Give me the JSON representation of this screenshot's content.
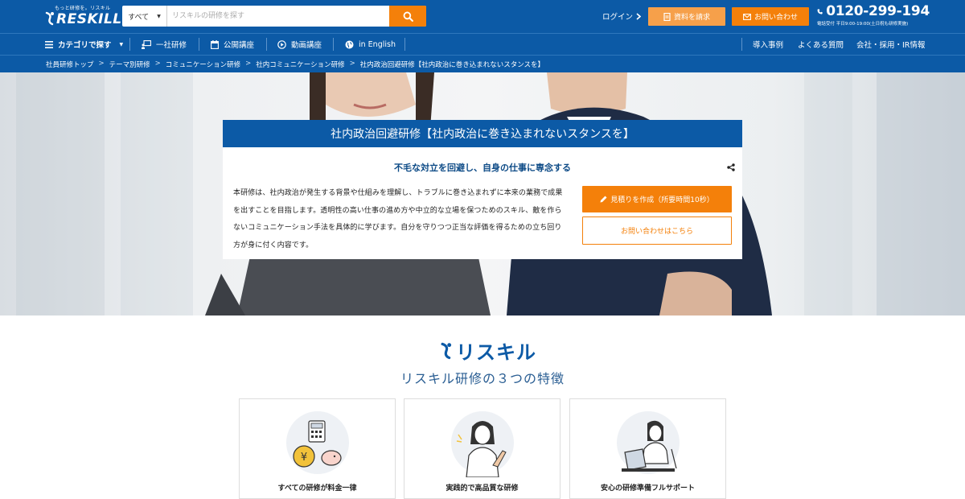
{
  "header": {
    "logo_tagline": "もっと研修を。リスキル",
    "logo_text": "RESKILL",
    "search": {
      "category": "すべて",
      "placeholder": "リスキルの研修を探す"
    },
    "login_label": "ログイン",
    "request_docs_label": "資料を請求",
    "contact_label": "お問い合わせ",
    "phone": "0120-299-194",
    "phone_hours": "電話受付 平日9:00-19:00(土日祝も研修実施)"
  },
  "nav": {
    "category_label": "カテゴリで探す",
    "items": [
      {
        "label": "一社研修",
        "icon": "presentation-icon"
      },
      {
        "label": "公開講座",
        "icon": "calendar-icon"
      },
      {
        "label": "動画講座",
        "icon": "play-circle-icon"
      },
      {
        "label": "in English",
        "icon": "globe-icon"
      }
    ],
    "right_items": [
      "導入事例",
      "よくある質問",
      "会社・採用・IR情報"
    ]
  },
  "breadcrumb": [
    "社員研修トップ",
    "テーマ別研修",
    "コミュニケーション研修",
    "社内コミュニケーション研修",
    "社内政治回避研修【社内政治に巻き込まれないスタンスを】"
  ],
  "course": {
    "title": "社内政治回避研修【社内政治に巻き込まれないスタンスを】",
    "subtitle": "不毛な対立を回避し、自身の仕事に専念する",
    "description": "本研修は、社内政治が発生する背景や仕組みを理解し、トラブルに巻き込まれずに本来の業務で成果を出すことを目指します。透明性の高い仕事の進め方や中立的な立場を保つためのスキル、敵を作らないコミュニケーション手法を具体的に学びます。自分を守りつつ正当な評価を得るための立ち回り方が身に付く内容です。",
    "estimate_label": "見積りを作成（所要時間10秒）",
    "inquiry_label": "お問い合わせはこちら"
  },
  "features": {
    "brand": "リスキル",
    "title": "リスキル研修の３つの特徴",
    "cards": [
      {
        "label": "すべての研修が料金一律",
        "icon": "calculator-coin-icon"
      },
      {
        "label": "実践的で高品質な研修",
        "icon": "instructor-icon"
      },
      {
        "label": "安心の研修準備フルサポート",
        "icon": "support-operator-icon"
      }
    ]
  },
  "colors": {
    "primary": "#0c5aa6",
    "accent": "#f4800a"
  }
}
